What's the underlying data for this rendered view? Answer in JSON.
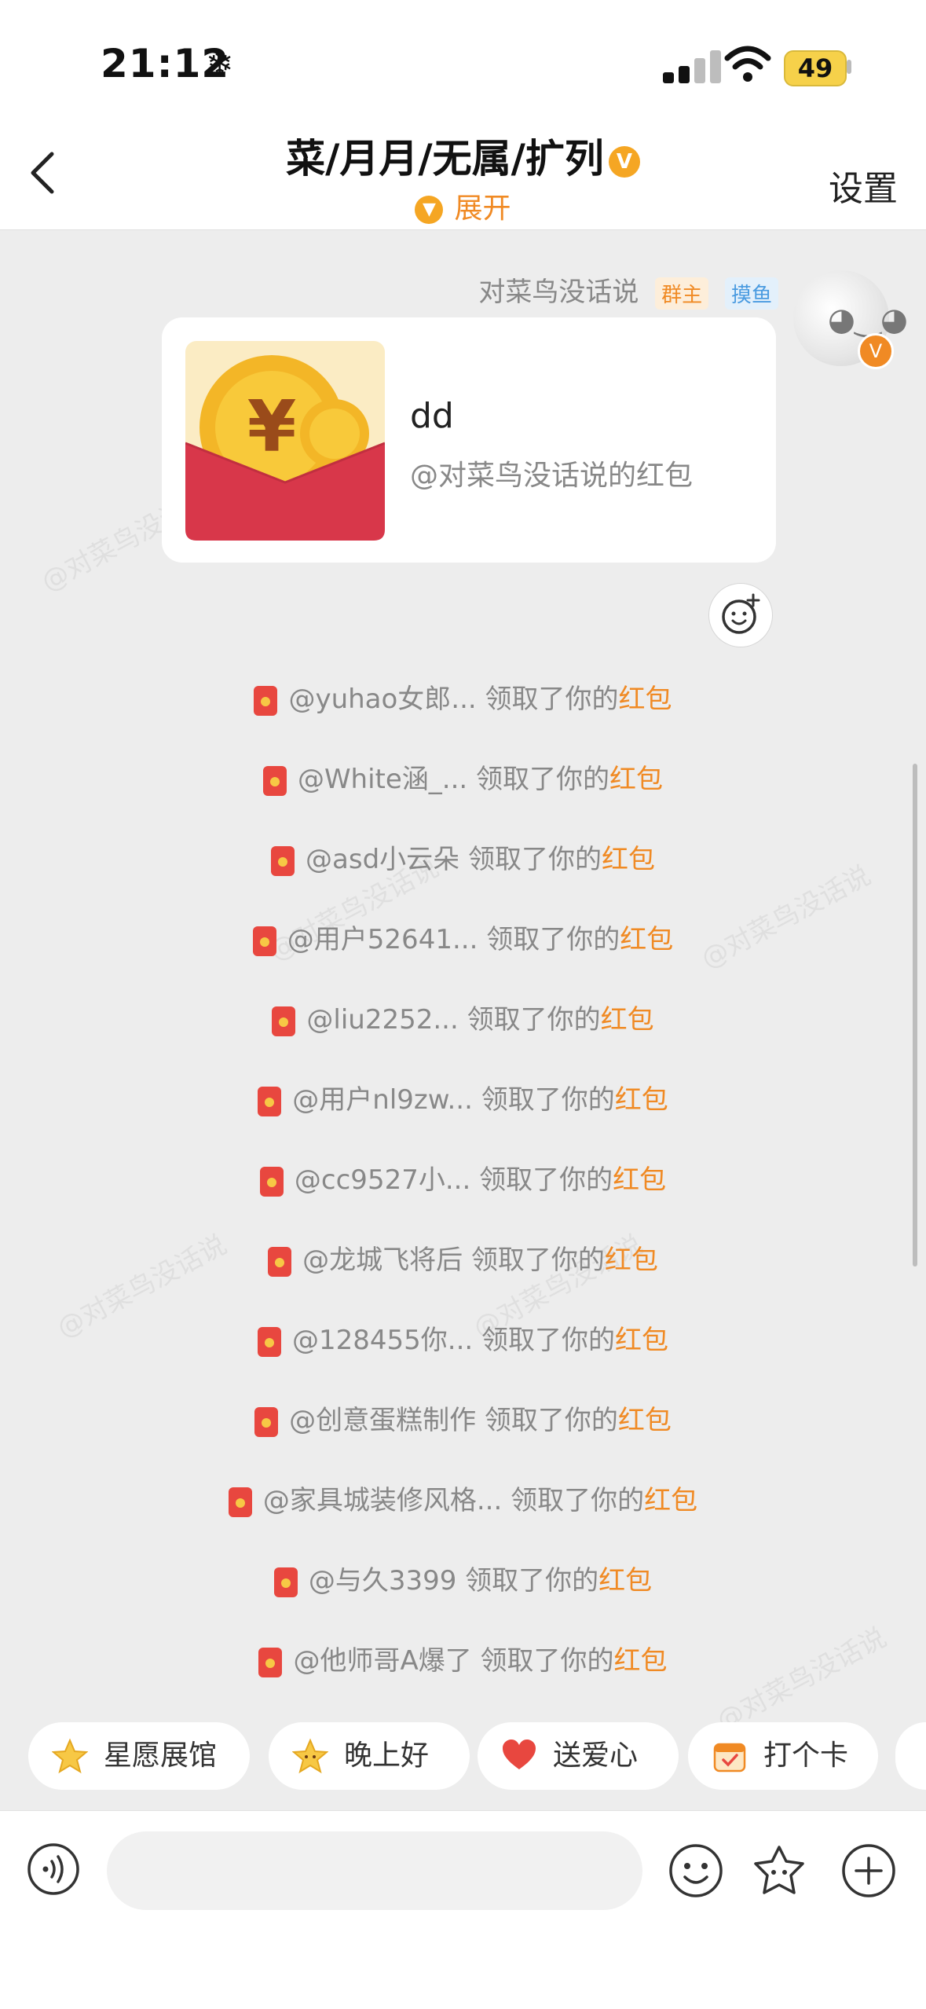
{
  "status_bar": {
    "time": "21:12",
    "weather_icon": "snowflake-icon",
    "battery": "49"
  },
  "header": {
    "title": "菜/月月/无属/扩列",
    "expand_label": "展开",
    "settings_label": "设置"
  },
  "message": {
    "sender_name": "对菜鸟没话说",
    "tags": [
      "群主",
      "摸鱼"
    ],
    "red_packet": {
      "title": "dd",
      "subtitle": "@对菜鸟没话说的红包"
    }
  },
  "claims": [
    {
      "user": "@yuhao女郎...",
      "action": " 领取了你的",
      "item": "红包"
    },
    {
      "user": "@White涵_...",
      "action": " 领取了你的",
      "item": "红包"
    },
    {
      "user": "@asd小云朵",
      "action": " 领取了你的",
      "item": "红包"
    },
    {
      "user": "@用户52641...",
      "action": " 领取了你的",
      "item": "红包"
    },
    {
      "user": "@liu2252...",
      "action": " 领取了你的",
      "item": "红包"
    },
    {
      "user": "@用户nl9zw...",
      "action": " 领取了你的",
      "item": "红包"
    },
    {
      "user": "@cc9527小...",
      "action": " 领取了你的",
      "item": "红包"
    },
    {
      "user": "@龙城飞将后",
      "action": " 领取了你的",
      "item": "红包"
    },
    {
      "user": "@128455你...",
      "action": " 领取了你的",
      "item": "红包"
    },
    {
      "user": "@创意蛋糕制作",
      "action": " 领取了你的",
      "item": "红包"
    },
    {
      "user": "@家具城装修风格...",
      "action": " 领取了你的",
      "item": "红包"
    },
    {
      "user": "@与久3399",
      "action": " 领取了你的",
      "item": "红包"
    },
    {
      "user": "@他师哥A爆了",
      "action": " 领取了你的",
      "item": "红包"
    }
  ],
  "quick_actions": [
    {
      "label": "星愿展馆",
      "icon": "star-icon"
    },
    {
      "label": "晚上好",
      "icon": "star-face-icon"
    },
    {
      "label": "送爱心",
      "icon": "heart-icon"
    },
    {
      "label": "打个卡",
      "icon": "calendar-icon"
    }
  ],
  "watermark_text": "@对菜鸟没话说",
  "colors": {
    "accent": "#f08a24",
    "red_packet": "#e8473f",
    "background": "#ededed"
  }
}
